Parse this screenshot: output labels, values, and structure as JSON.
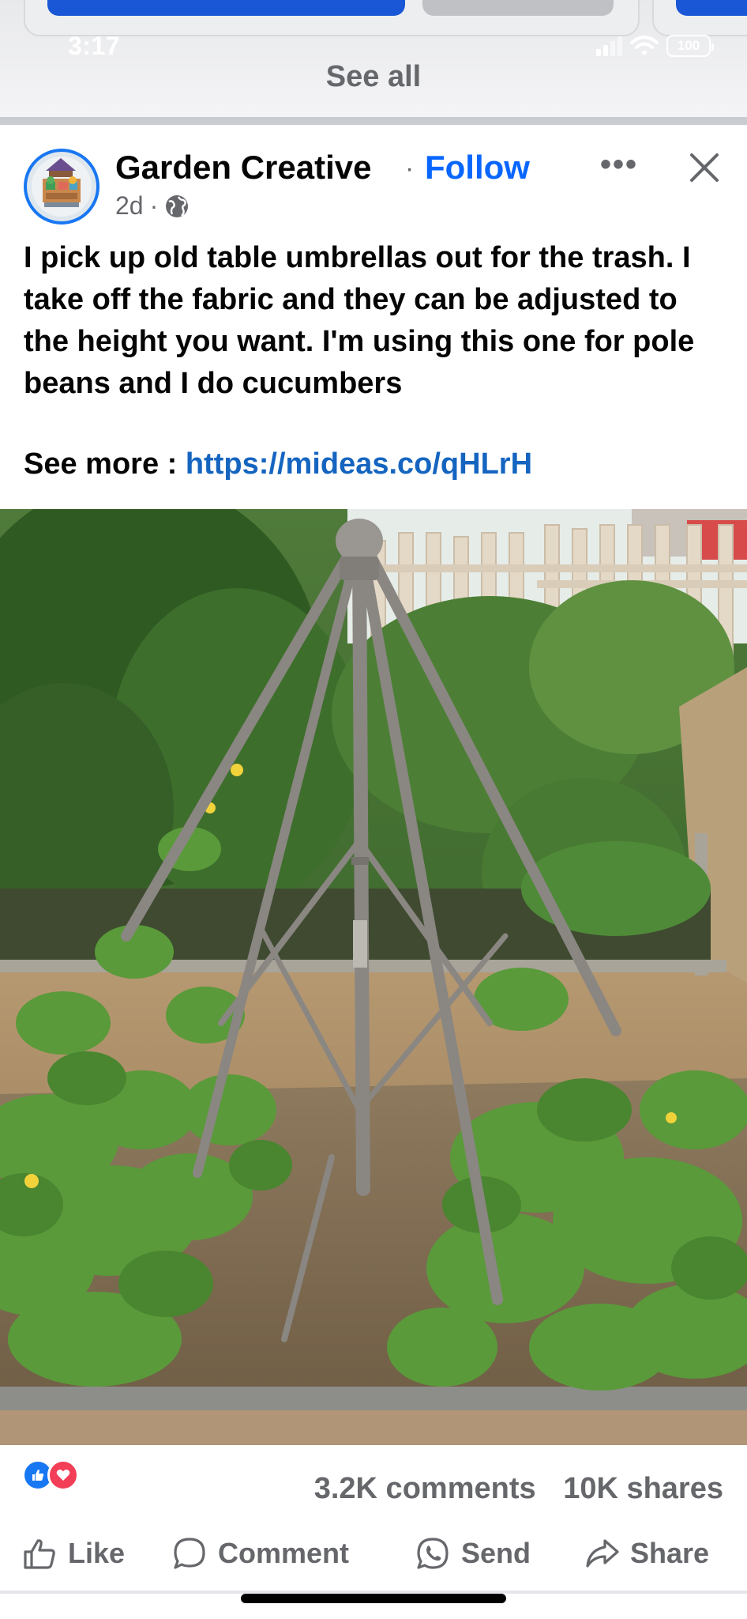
{
  "status_bar": {
    "time": "3:17",
    "battery": "100"
  },
  "header": {
    "see_all": "See all"
  },
  "post": {
    "page_name": "Garden Creative",
    "separator": "·",
    "follow_label": "Follow",
    "age": "2d",
    "meta_separator": "·",
    "audience_icon": "globe-icon",
    "more_icon": "more-horizontal-icon",
    "close_icon": "close-icon",
    "text": "I pick up old table umbrellas out for the trash. I take off the fabric and they can be adjusted to the height you want. I'm using this one for pole beans and I do cucumbers",
    "see_more_label": "See more :",
    "link": "https://mideas.co/qHLrH"
  },
  "reactions": {
    "icons": [
      "like-reaction-icon",
      "love-reaction-icon"
    ],
    "comments": "3.2K comments",
    "shares": "10K shares"
  },
  "actions": {
    "like": "Like",
    "comment": "Comment",
    "send": "Send",
    "share": "Share"
  },
  "colors": {
    "follow_blue": "#0866ff",
    "link_blue": "#1565c0",
    "secondary_text": "#65676b",
    "like_blue": "#1877f2",
    "love_red": "#f33e58"
  }
}
